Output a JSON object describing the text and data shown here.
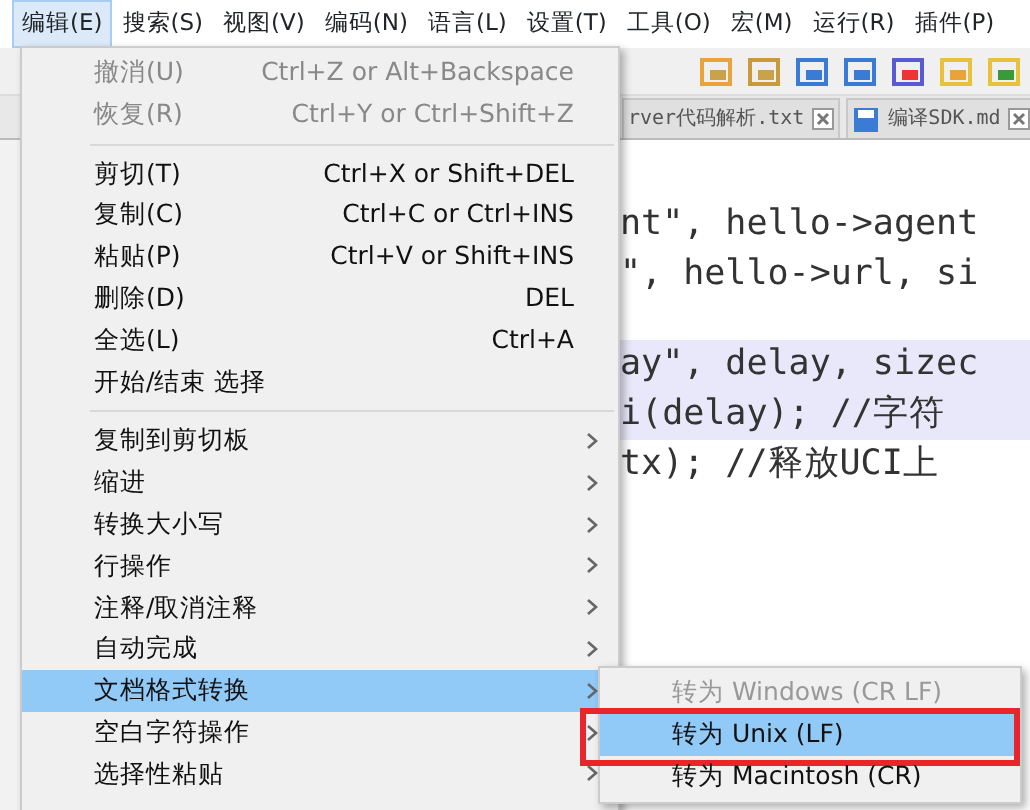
{
  "menubar": [
    {
      "label": "编辑(E)",
      "selected": true
    },
    {
      "label": "搜索(S)",
      "selected": false
    },
    {
      "label": "视图(V)",
      "selected": false
    },
    {
      "label": "编码(N)",
      "selected": false
    },
    {
      "label": "语言(L)",
      "selected": false
    },
    {
      "label": "设置(T)",
      "selected": false
    },
    {
      "label": "工具(O)",
      "selected": false
    },
    {
      "label": "宏(M)",
      "selected": false
    },
    {
      "label": "运行(R)",
      "selected": false
    },
    {
      "label": "插件(P)",
      "selected": false
    }
  ],
  "tabs": [
    {
      "label": "rver代码解析.txt",
      "selected": false
    },
    {
      "label": "编译SDK.md",
      "selected": false
    }
  ],
  "code_blocks": [
    [
      {
        "text": "nt\", hello->agent",
        "highlight": false
      },
      {
        "text": "\", hello->url, si",
        "highlight": false
      }
    ],
    [
      {
        "text": "ay\", delay, sizec",
        "highlight": true
      },
      {
        "text": "i(delay); //字符",
        "highlight": true
      },
      {
        "text": "tx); //释放UCI上",
        "highlight": false
      }
    ]
  ],
  "menu": [
    {
      "kind": "item",
      "label": "撤消(U)",
      "shortcut": "Ctrl+Z or Alt+Backspace",
      "disabled": true,
      "selected": false
    },
    {
      "kind": "item",
      "label": "恢复(R)",
      "shortcut": "Ctrl+Y or Ctrl+Shift+Z",
      "disabled": true,
      "selected": false
    },
    {
      "kind": "separator"
    },
    {
      "kind": "item",
      "label": "剪切(T)",
      "shortcut": "Ctrl+X or Shift+DEL",
      "disabled": false,
      "selected": false
    },
    {
      "kind": "item",
      "label": "复制(C)",
      "shortcut": "Ctrl+C or Ctrl+INS",
      "disabled": false,
      "selected": false
    },
    {
      "kind": "item",
      "label": "粘贴(P)",
      "shortcut": "Ctrl+V or Shift+INS",
      "disabled": false,
      "selected": false
    },
    {
      "kind": "item",
      "label": "删除(D)",
      "shortcut": "DEL",
      "disabled": false,
      "selected": false
    },
    {
      "kind": "item",
      "label": "全选(L)",
      "shortcut": "Ctrl+A",
      "disabled": false,
      "selected": false
    },
    {
      "kind": "item",
      "label": "开始/结束 选择",
      "disabled": false,
      "selected": false
    },
    {
      "kind": "separator"
    },
    {
      "kind": "submenu",
      "label": "复制到剪切板",
      "disabled": false,
      "selected": false
    },
    {
      "kind": "submenu",
      "label": "缩进",
      "disabled": false,
      "selected": false
    },
    {
      "kind": "submenu",
      "label": "转换大小写",
      "disabled": false,
      "selected": false
    },
    {
      "kind": "submenu",
      "label": "行操作",
      "disabled": false,
      "selected": false
    },
    {
      "kind": "submenu",
      "label": "注释/取消注释",
      "disabled": false,
      "selected": false
    },
    {
      "kind": "submenu",
      "label": "自动完成",
      "disabled": false,
      "selected": false
    },
    {
      "kind": "submenu",
      "label": "文档格式转换",
      "disabled": false,
      "selected": true
    },
    {
      "kind": "submenu",
      "label": "空白字符操作",
      "disabled": false,
      "selected": false
    },
    {
      "kind": "submenu",
      "label": "选择性粘贴",
      "disabled": false,
      "selected": false
    }
  ],
  "submenu": [
    {
      "label": "转为 Windows (CR LF)",
      "disabled": true,
      "selected": false
    },
    {
      "label": "转为 Unix (LF)",
      "disabled": false,
      "selected": true,
      "annotated": true
    },
    {
      "label": "转为 Macintosh (CR)",
      "disabled": false,
      "selected": false
    }
  ]
}
